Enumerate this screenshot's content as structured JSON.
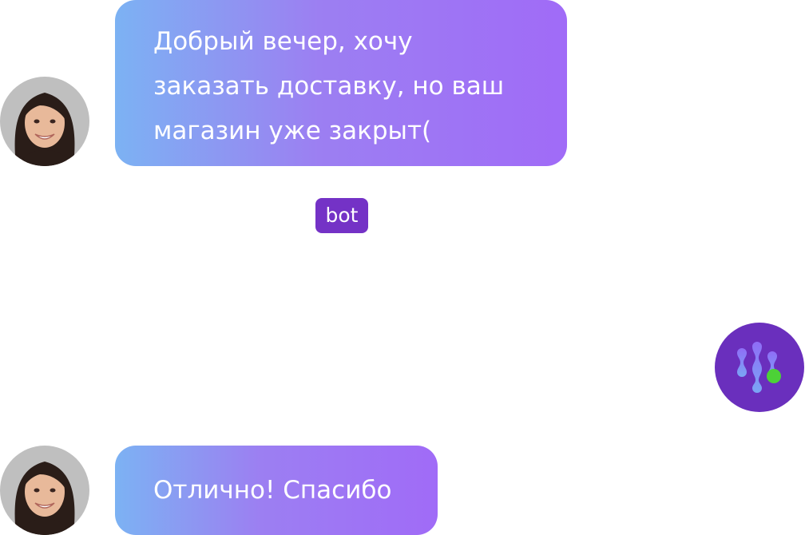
{
  "messages": [
    {
      "sender": "user",
      "text": "Добрый вечер, хочу заказать доставку, но ваш магазин уже закрыт("
    },
    {
      "sender": "user",
      "text": "Отлично! Спасибо"
    }
  ],
  "bot_label": "bot",
  "bot_avatar_icon": "bot-logo-icon",
  "colors": {
    "bubble_gradient_start": "#7cb2f3",
    "bubble_gradient_end": "#a06bf7",
    "bot_badge": "#7432c6",
    "bot_avatar_bg": "#6a2fbd",
    "online_dot": "#4cd137"
  }
}
